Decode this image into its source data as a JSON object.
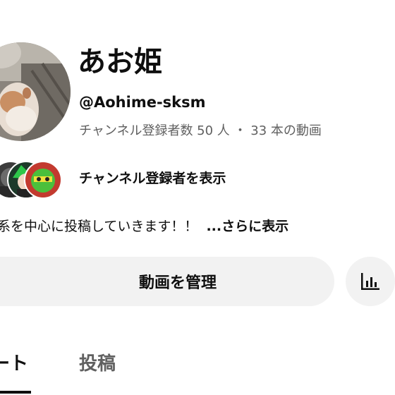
{
  "channel": {
    "name": "あお姫",
    "handle": "@Aohime-sksm",
    "stats": "チャンネル登録者数 50 人 ・ 33 本の動画"
  },
  "subscribers": {
    "show_label": "チャンネル登録者を表示",
    "faces": [
      "subscriber-avatar-1",
      "subscriber-avatar-2",
      "subscriber-avatar-3"
    ]
  },
  "description": {
    "text": "系を中心に投稿していきます！！",
    "more_label": "...さらに表示"
  },
  "actions": {
    "manage_label": "動画を管理",
    "analytics_icon": "analytics-icon"
  },
  "tabs": [
    {
      "label": "ート",
      "selected": true
    },
    {
      "label": "投稿",
      "selected": false
    }
  ],
  "colors": {
    "text_primary": "#0f0f0f",
    "text_secondary": "#606060",
    "button_bg": "#f2f2f2"
  }
}
